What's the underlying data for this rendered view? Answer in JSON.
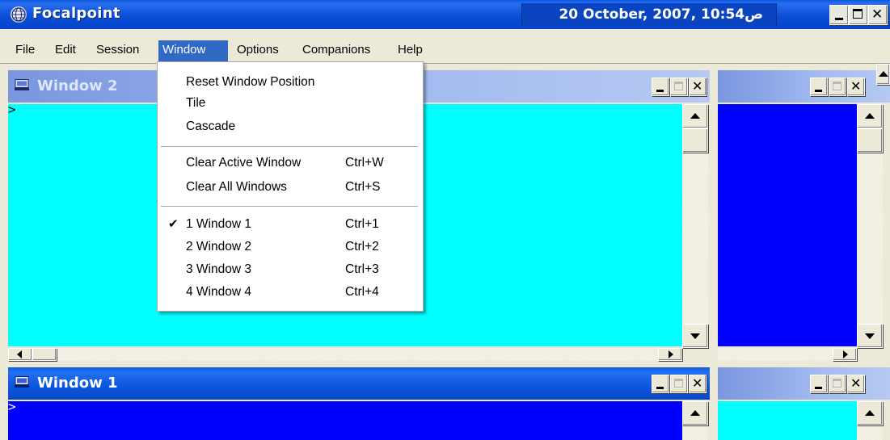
{
  "app": {
    "title": "Focalpoint",
    "clock": "20 October, 2007, ص10:54"
  },
  "menubar": {
    "items": [
      "File",
      "Edit",
      "Session",
      "Window",
      "Options",
      "Companions",
      "Help"
    ],
    "open_item": "Window"
  },
  "window_menu": {
    "groups": [
      {
        "items": [
          {
            "label": "Reset Window Position",
            "shortcut": ""
          },
          {
            "label": "Tile",
            "shortcut": ""
          },
          {
            "label": "Cascade",
            "shortcut": ""
          }
        ]
      },
      {
        "items": [
          {
            "label": "Clear Active Window",
            "shortcut": "Ctrl+W"
          },
          {
            "label": "Clear All Windows",
            "shortcut": "Ctrl+S"
          }
        ]
      },
      {
        "items": [
          {
            "label": "1 Window 1",
            "shortcut": "Ctrl+1",
            "checked": true
          },
          {
            "label": "2 Window 2",
            "shortcut": "Ctrl+2"
          },
          {
            "label": "3 Window 3",
            "shortcut": "Ctrl+3"
          },
          {
            "label": "4 Window 4",
            "shortcut": "Ctrl+4"
          }
        ]
      }
    ]
  },
  "child_windows": [
    {
      "title": "Window 2",
      "active": false,
      "background": "#00ffff",
      "prompt": ">"
    },
    {
      "title": "",
      "active": false,
      "background": "#0000ff"
    },
    {
      "title": "Window 1",
      "active": true,
      "background": "#0000ff",
      "prompt": ">"
    },
    {
      "title": "",
      "active": false,
      "background": "#00ffff"
    }
  ],
  "colors": {
    "titlebar_active": "#0a4fd6",
    "titlebar_inactive": "#a3bbf0",
    "menu_highlight": "#316ac5",
    "cyan": "#00ffff",
    "blue": "#0000ff"
  }
}
